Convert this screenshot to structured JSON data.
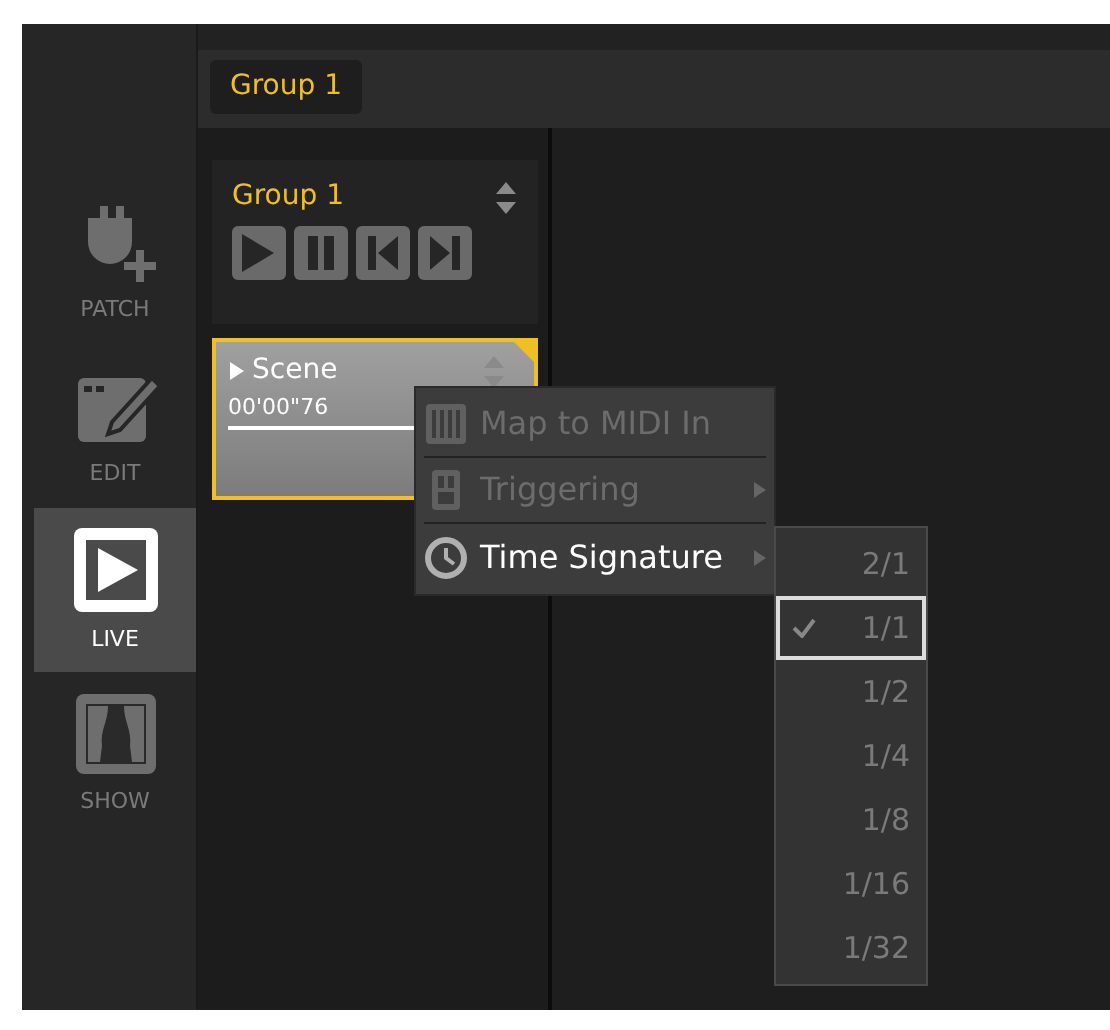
{
  "sidebar": {
    "items": [
      {
        "kind": "patch",
        "label": "PATCH",
        "selected": false
      },
      {
        "kind": "edit",
        "label": "EDIT",
        "selected": false
      },
      {
        "kind": "live",
        "label": "LIVE",
        "selected": true
      },
      {
        "kind": "show",
        "label": "SHOW",
        "selected": false
      }
    ]
  },
  "tabs": [
    {
      "label": "Group 1",
      "selected": true
    }
  ],
  "group_panel": {
    "title": "Group 1",
    "buttons": [
      {
        "kind": "play"
      },
      {
        "kind": "pause"
      },
      {
        "kind": "prev"
      },
      {
        "kind": "next"
      }
    ]
  },
  "scene": {
    "title": "Scene",
    "time": "00'00\"76",
    "selected": true
  },
  "context_menu": {
    "items": [
      {
        "kind": "midi",
        "label": "Map to MIDI In",
        "disabled": true,
        "submenu": false
      },
      {
        "kind": "trigger",
        "label": "Triggering",
        "disabled": true,
        "submenu": true
      },
      {
        "kind": "clock",
        "label": "Time Signature",
        "disabled": false,
        "submenu": true
      }
    ]
  },
  "submenu": {
    "items": [
      {
        "label": "2/1",
        "selected": false
      },
      {
        "label": "1/1",
        "selected": true
      },
      {
        "label": "1/2",
        "selected": false
      },
      {
        "label": "1/4",
        "selected": false
      },
      {
        "label": "1/8",
        "selected": false
      },
      {
        "label": "1/16",
        "selected": false
      },
      {
        "label": "1/32",
        "selected": false
      }
    ]
  }
}
